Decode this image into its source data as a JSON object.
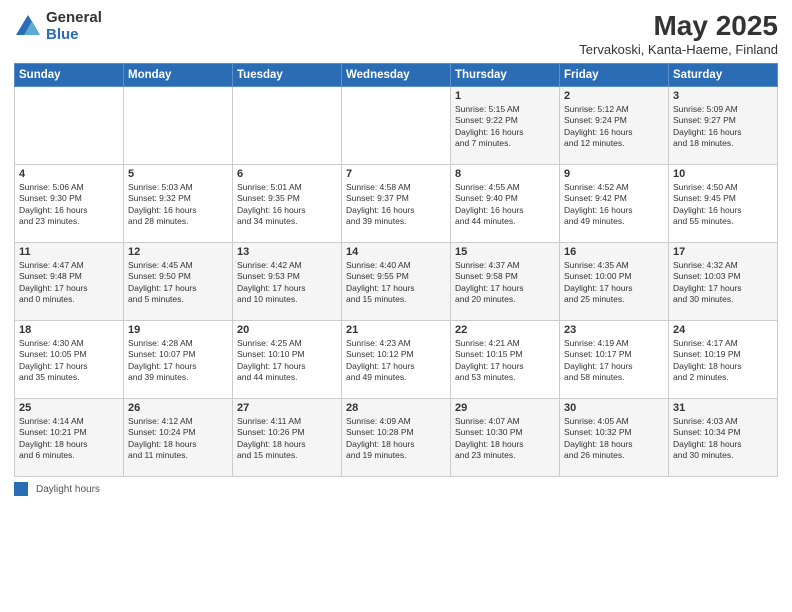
{
  "header": {
    "logo_general": "General",
    "logo_blue": "Blue",
    "title": "May 2025",
    "subtitle": "Tervakoski, Kanta-Haeme, Finland"
  },
  "days_of_week": [
    "Sunday",
    "Monday",
    "Tuesday",
    "Wednesday",
    "Thursday",
    "Friday",
    "Saturday"
  ],
  "footer": {
    "legend_label": "Daylight hours"
  },
  "weeks": [
    {
      "days": [
        {
          "num": "",
          "info": ""
        },
        {
          "num": "",
          "info": ""
        },
        {
          "num": "",
          "info": ""
        },
        {
          "num": "",
          "info": ""
        },
        {
          "num": "1",
          "info": "Sunrise: 5:15 AM\nSunset: 9:22 PM\nDaylight: 16 hours\nand 7 minutes."
        },
        {
          "num": "2",
          "info": "Sunrise: 5:12 AM\nSunset: 9:24 PM\nDaylight: 16 hours\nand 12 minutes."
        },
        {
          "num": "3",
          "info": "Sunrise: 5:09 AM\nSunset: 9:27 PM\nDaylight: 16 hours\nand 18 minutes."
        }
      ]
    },
    {
      "days": [
        {
          "num": "4",
          "info": "Sunrise: 5:06 AM\nSunset: 9:30 PM\nDaylight: 16 hours\nand 23 minutes."
        },
        {
          "num": "5",
          "info": "Sunrise: 5:03 AM\nSunset: 9:32 PM\nDaylight: 16 hours\nand 28 minutes."
        },
        {
          "num": "6",
          "info": "Sunrise: 5:01 AM\nSunset: 9:35 PM\nDaylight: 16 hours\nand 34 minutes."
        },
        {
          "num": "7",
          "info": "Sunrise: 4:58 AM\nSunset: 9:37 PM\nDaylight: 16 hours\nand 39 minutes."
        },
        {
          "num": "8",
          "info": "Sunrise: 4:55 AM\nSunset: 9:40 PM\nDaylight: 16 hours\nand 44 minutes."
        },
        {
          "num": "9",
          "info": "Sunrise: 4:52 AM\nSunset: 9:42 PM\nDaylight: 16 hours\nand 49 minutes."
        },
        {
          "num": "10",
          "info": "Sunrise: 4:50 AM\nSunset: 9:45 PM\nDaylight: 16 hours\nand 55 minutes."
        }
      ]
    },
    {
      "days": [
        {
          "num": "11",
          "info": "Sunrise: 4:47 AM\nSunset: 9:48 PM\nDaylight: 17 hours\nand 0 minutes."
        },
        {
          "num": "12",
          "info": "Sunrise: 4:45 AM\nSunset: 9:50 PM\nDaylight: 17 hours\nand 5 minutes."
        },
        {
          "num": "13",
          "info": "Sunrise: 4:42 AM\nSunset: 9:53 PM\nDaylight: 17 hours\nand 10 minutes."
        },
        {
          "num": "14",
          "info": "Sunrise: 4:40 AM\nSunset: 9:55 PM\nDaylight: 17 hours\nand 15 minutes."
        },
        {
          "num": "15",
          "info": "Sunrise: 4:37 AM\nSunset: 9:58 PM\nDaylight: 17 hours\nand 20 minutes."
        },
        {
          "num": "16",
          "info": "Sunrise: 4:35 AM\nSunset: 10:00 PM\nDaylight: 17 hours\nand 25 minutes."
        },
        {
          "num": "17",
          "info": "Sunrise: 4:32 AM\nSunset: 10:03 PM\nDaylight: 17 hours\nand 30 minutes."
        }
      ]
    },
    {
      "days": [
        {
          "num": "18",
          "info": "Sunrise: 4:30 AM\nSunset: 10:05 PM\nDaylight: 17 hours\nand 35 minutes."
        },
        {
          "num": "19",
          "info": "Sunrise: 4:28 AM\nSunset: 10:07 PM\nDaylight: 17 hours\nand 39 minutes."
        },
        {
          "num": "20",
          "info": "Sunrise: 4:25 AM\nSunset: 10:10 PM\nDaylight: 17 hours\nand 44 minutes."
        },
        {
          "num": "21",
          "info": "Sunrise: 4:23 AM\nSunset: 10:12 PM\nDaylight: 17 hours\nand 49 minutes."
        },
        {
          "num": "22",
          "info": "Sunrise: 4:21 AM\nSunset: 10:15 PM\nDaylight: 17 hours\nand 53 minutes."
        },
        {
          "num": "23",
          "info": "Sunrise: 4:19 AM\nSunset: 10:17 PM\nDaylight: 17 hours\nand 58 minutes."
        },
        {
          "num": "24",
          "info": "Sunrise: 4:17 AM\nSunset: 10:19 PM\nDaylight: 18 hours\nand 2 minutes."
        }
      ]
    },
    {
      "days": [
        {
          "num": "25",
          "info": "Sunrise: 4:14 AM\nSunset: 10:21 PM\nDaylight: 18 hours\nand 6 minutes."
        },
        {
          "num": "26",
          "info": "Sunrise: 4:12 AM\nSunset: 10:24 PM\nDaylight: 18 hours\nand 11 minutes."
        },
        {
          "num": "27",
          "info": "Sunrise: 4:11 AM\nSunset: 10:26 PM\nDaylight: 18 hours\nand 15 minutes."
        },
        {
          "num": "28",
          "info": "Sunrise: 4:09 AM\nSunset: 10:28 PM\nDaylight: 18 hours\nand 19 minutes."
        },
        {
          "num": "29",
          "info": "Sunrise: 4:07 AM\nSunset: 10:30 PM\nDaylight: 18 hours\nand 23 minutes."
        },
        {
          "num": "30",
          "info": "Sunrise: 4:05 AM\nSunset: 10:32 PM\nDaylight: 18 hours\nand 26 minutes."
        },
        {
          "num": "31",
          "info": "Sunrise: 4:03 AM\nSunset: 10:34 PM\nDaylight: 18 hours\nand 30 minutes."
        }
      ]
    }
  ]
}
